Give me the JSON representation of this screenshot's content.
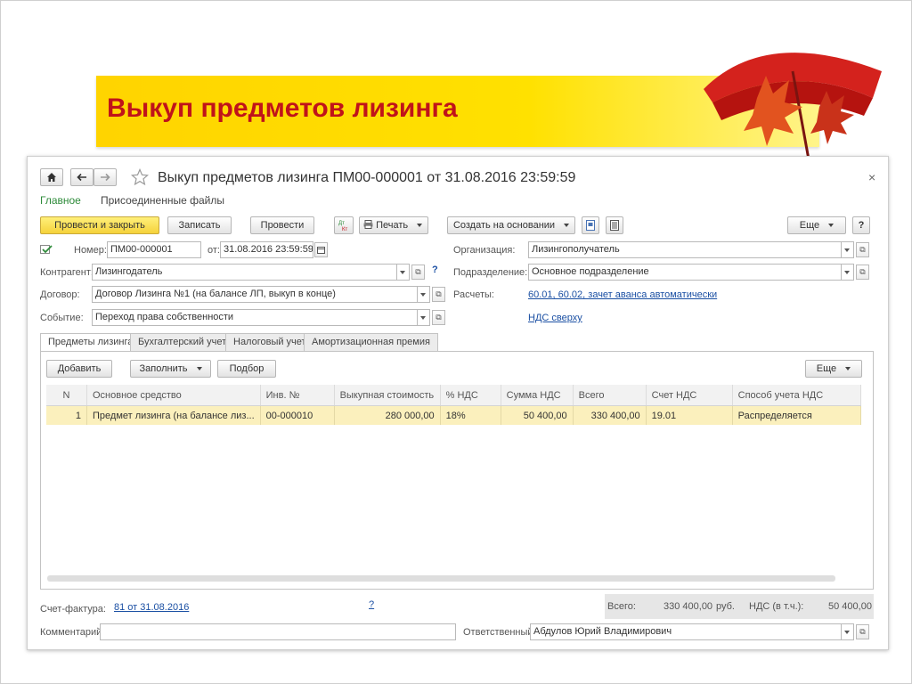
{
  "slide": {
    "title": "Выкуп предметов лизинга"
  },
  "window": {
    "title": "Выкуп предметов лизинга ПМ00-000001 от 31.08.2016 23:59:59",
    "close": "×",
    "nav_tabs": {
      "main": "Главное",
      "files": "Присоединенные файлы"
    }
  },
  "toolbar": {
    "post_close": "Провести и закрыть",
    "save": "Записать",
    "post": "Провести",
    "print": "Печать",
    "create_based": "Создать на основании",
    "more": "Еще",
    "help": "?"
  },
  "form": {
    "number_label": "Номер:",
    "number_value": "ПМ00-000001",
    "date_label": "от:",
    "date_value": "31.08.2016 23:59:59",
    "org_label": "Организация:",
    "org_value": "Лизингополучатель",
    "counterparty_label": "Контрагент:",
    "counterparty_value": "Лизингодатель",
    "subdivision_label": "Подразделение:",
    "subdivision_value": "Основное подразделение",
    "contract_label": "Договор:",
    "contract_value": "Договор Лизинга №1 (на балансе ЛП, выкуп в конце)",
    "settlements_label": "Расчеты:",
    "settlements_link": "60.01, 60.02, зачет аванса автоматически",
    "event_label": "Событие:",
    "event_value": "Переход права собственности",
    "vat_link": "НДС сверху",
    "question": "?"
  },
  "tabs": [
    "Предметы лизинга",
    "Бухгалтерский учет",
    "Налоговый учет",
    "Амортизационная премия"
  ],
  "table_toolbar": {
    "add": "Добавить",
    "fill": "Заполнить",
    "pick": "Подбор",
    "more": "Еще"
  },
  "table": {
    "headers": [
      "N",
      "Основное средство",
      "Инв. №",
      "Выкупная стоимость",
      "% НДС",
      "Сумма НДС",
      "Всего",
      "Счет НДС",
      "Способ учета НДС"
    ],
    "rows": [
      [
        "1",
        "Предмет лизинга (на балансе лиз...",
        "00-000010",
        "280 000,00",
        "18%",
        "50 400,00",
        "330 400,00",
        "19.01",
        "Распределяется"
      ]
    ]
  },
  "footer": {
    "invoice_label": "Счет-фактура:",
    "invoice_link": "81 от 31.08.2016",
    "question": "?",
    "total_label": "Всего:",
    "total_value": "330 400,00",
    "currency": "руб.",
    "vat_label": "НДС (в т.ч.):",
    "vat_value": "50 400,00",
    "comment_label": "Комментарий:",
    "comment_value": "",
    "responsible_label": "Ответственный:",
    "responsible_value": "Абдулов Юрий Владимирович"
  }
}
